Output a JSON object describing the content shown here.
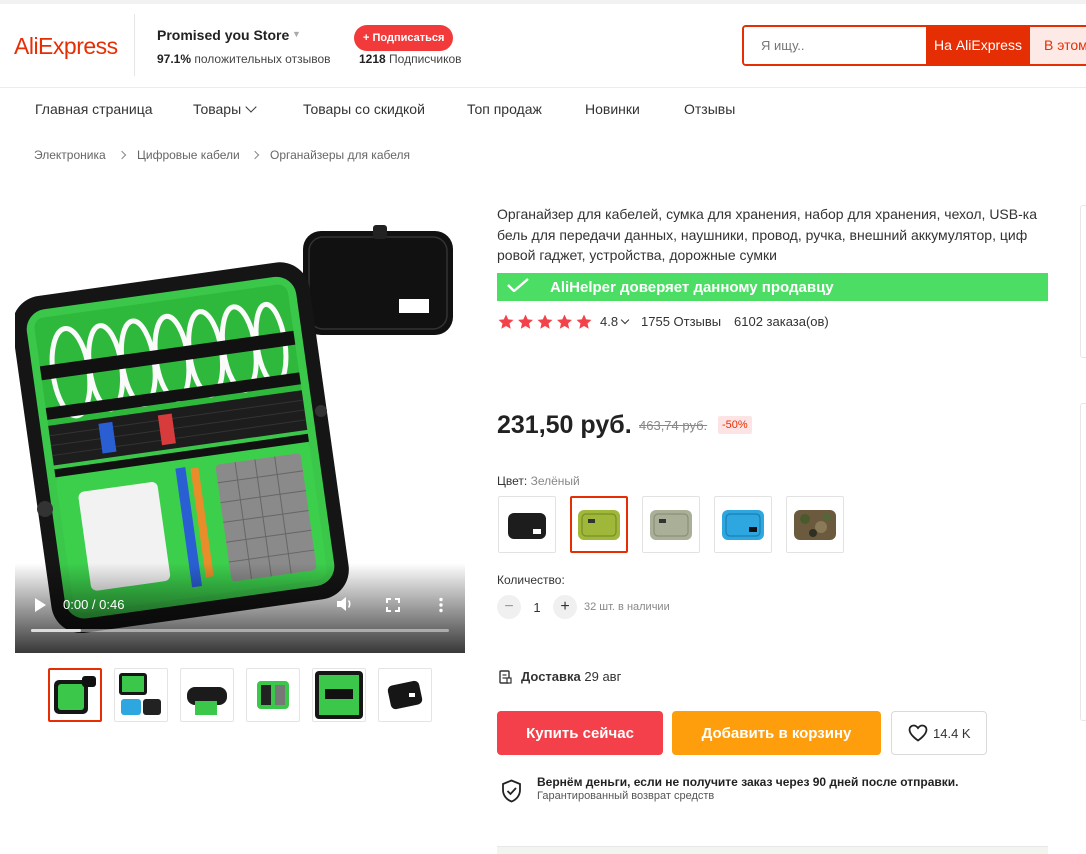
{
  "header": {
    "logo": "AliExpress",
    "store_name": "Promised you Store",
    "positive_pct": "97.1%",
    "positive_label": "положительных отзывов",
    "subscribers_count": "1218",
    "subscribers_label": "Подписчиков",
    "subscribe_label": "+ Подписаться",
    "search_placeholder": "Я ищу..",
    "search_ali_label": "На AliExpress",
    "search_store_label": "В этом магазине"
  },
  "nav": {
    "items": [
      "Главная страница",
      "Товары",
      "Товары со скидкой",
      "Топ продаж",
      "Новинки",
      "Отзывы"
    ]
  },
  "breadcrumb": [
    "Электроника",
    "Цифровые кабели",
    "Органайзеры для кабеля"
  ],
  "video": {
    "time": "0:00 / 0:46",
    "progress_fraction": 0.12
  },
  "product": {
    "title": "Органайзер для кабелей, сумка для хранения, набор для хранения, чехол, USB-ка бель для передачи данных, наушники, провод, ручка, внешний аккумулятор, циф ровой гаджет, устройства, дорожные сумки",
    "trust_text": "AliHelper доверяет данному продавцу",
    "rating": "4.8",
    "reviews": "1755 Отзывы",
    "orders": "6102 заказа(ов)",
    "price": "231,50 руб.",
    "old_price": "463,74 руб.",
    "discount": "-50%",
    "color_label": "Цвет:",
    "color_value": "Зелёный",
    "quantity_label": "Количество:",
    "quantity": "1",
    "minus": "−",
    "plus": "+",
    "stock": "32 шт. в наличии",
    "delivery_label": "Доставка",
    "delivery_date": "29 авг",
    "buy_label": "Купить сейчас",
    "cart_label": "Добавить в корзину",
    "wish_count": "14.4 K",
    "guarantee_title": "Вернём деньги, если не получите заказ через 90 дней после отправки.",
    "guarantee_sub": "Гарантированный возврат средств"
  },
  "colors": {
    "accent": "#e62e04",
    "buy": "#f4404a",
    "cart": "#ff9e0d",
    "trust": "#4cde64",
    "star": "#f3424a",
    "swatches": [
      "#1d1d1d",
      "#a0b83a",
      "#aab098",
      "#2ea6e0",
      "#6b5a3e"
    ]
  }
}
